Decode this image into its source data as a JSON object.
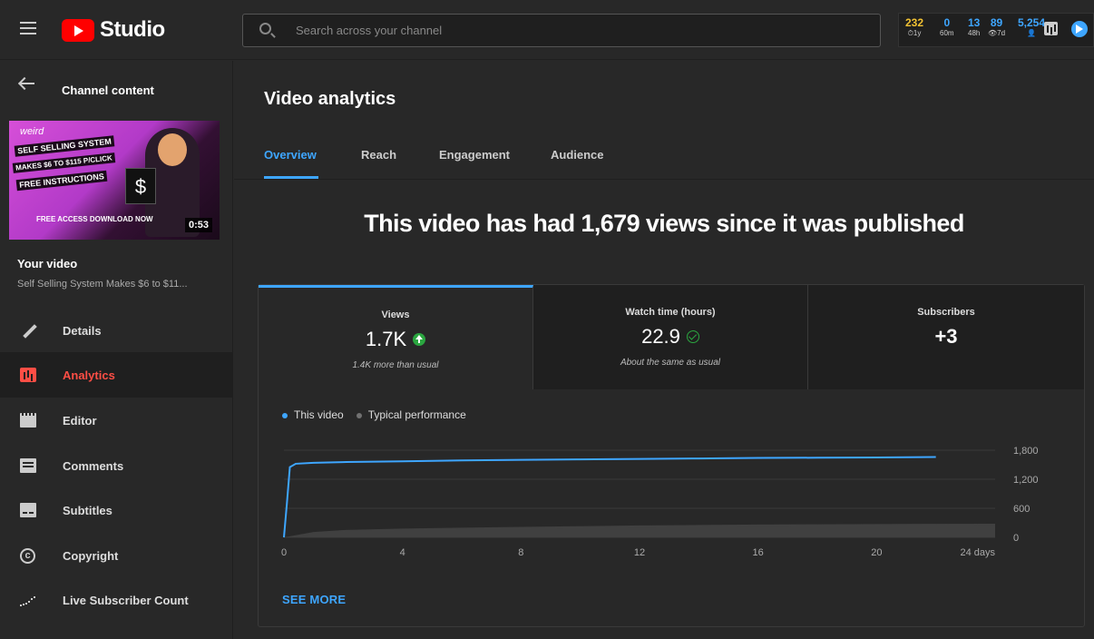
{
  "header": {
    "logo_text": "Studio",
    "search_placeholder": "Search across your channel",
    "stats": [
      {
        "value": "232",
        "label": "⏱1y",
        "color": "#f2c233"
      },
      {
        "value": "0",
        "label": "60m",
        "color": "#3ea6ff"
      },
      {
        "value": "13",
        "label": "48h",
        "color": "#3ea6ff"
      },
      {
        "value": "89",
        "label": "👁7d",
        "color": "#3ea6ff"
      },
      {
        "value": "5,254",
        "label": "👤",
        "color": "#3ea6ff"
      }
    ]
  },
  "sidebar": {
    "back_title": "Channel content",
    "thumbnail": {
      "weird": "weird",
      "line1": "SELF SELLING SYSTEM",
      "line2": "MAKES $6 TO $115 P/CLICK",
      "line3": "FREE INSTRUCTIONS",
      "bottom": "FREE ACCESS   DOWNLOAD NOW",
      "duration": "0:53"
    },
    "your_video_label": "Your video",
    "video_title": "Self Selling System Makes $6 to $11...",
    "nav": [
      {
        "label": "Details",
        "icon": "pencil-icon"
      },
      {
        "label": "Analytics",
        "icon": "analytics-icon",
        "active": true
      },
      {
        "label": "Editor",
        "icon": "editor-icon"
      },
      {
        "label": "Comments",
        "icon": "comments-icon"
      },
      {
        "label": "Subtitles",
        "icon": "subtitles-icon"
      },
      {
        "label": "Copyright",
        "icon": "copyright-icon"
      },
      {
        "label": "Live Subscriber Count",
        "icon": "live-subscriber-count-icon"
      }
    ]
  },
  "main": {
    "title": "Video analytics",
    "tabs": [
      "Overview",
      "Reach",
      "Engagement",
      "Audience"
    ],
    "active_tab": "Overview",
    "headline": "This video has had 1,679 views since it was published",
    "metrics": [
      {
        "label": "Views",
        "value": "1.7K",
        "note": "1.4K more than usual",
        "indicator": "up-arrow"
      },
      {
        "label": "Watch time (hours)",
        "value": "22.9",
        "note": "About the same as usual",
        "indicator": "check"
      },
      {
        "label": "Subscribers",
        "value": "+3",
        "note": ""
      }
    ],
    "legend": [
      {
        "label": "This video",
        "color": "#3ea6ff"
      },
      {
        "label": "Typical performance",
        "color": "#717171"
      }
    ],
    "see_more": "SEE MORE"
  },
  "chart_data": {
    "type": "line",
    "x_unit": "days",
    "xticks": [
      0,
      4,
      8,
      12,
      16,
      20
    ],
    "xtick_labels": [
      "0",
      "4",
      "8",
      "12",
      "16",
      "20",
      "24 days"
    ],
    "yticks": [
      0,
      600,
      1200,
      1800
    ],
    "ytick_labels": [
      "0",
      "600",
      "1,200",
      "1,800"
    ],
    "xlim": [
      0,
      24
    ],
    "ylim": [
      0,
      1800
    ],
    "series": [
      {
        "name": "This video",
        "color": "#3ea6ff",
        "x": [
          0,
          0.1,
          0.2,
          0.4,
          1,
          2,
          4,
          6,
          8,
          10,
          12,
          14,
          16,
          18,
          20,
          22
        ],
        "y": [
          0,
          700,
          1450,
          1520,
          1540,
          1555,
          1570,
          1590,
          1600,
          1610,
          1620,
          1630,
          1640,
          1645,
          1650,
          1660
        ]
      },
      {
        "name": "Typical performance",
        "color": "#717171",
        "x": [
          0,
          1,
          2,
          4,
          6,
          8,
          10,
          12,
          14,
          16,
          18,
          20,
          22,
          24
        ],
        "y": [
          0,
          110,
          150,
          180,
          200,
          215,
          230,
          245,
          255,
          265,
          270,
          275,
          280,
          282
        ]
      }
    ]
  }
}
